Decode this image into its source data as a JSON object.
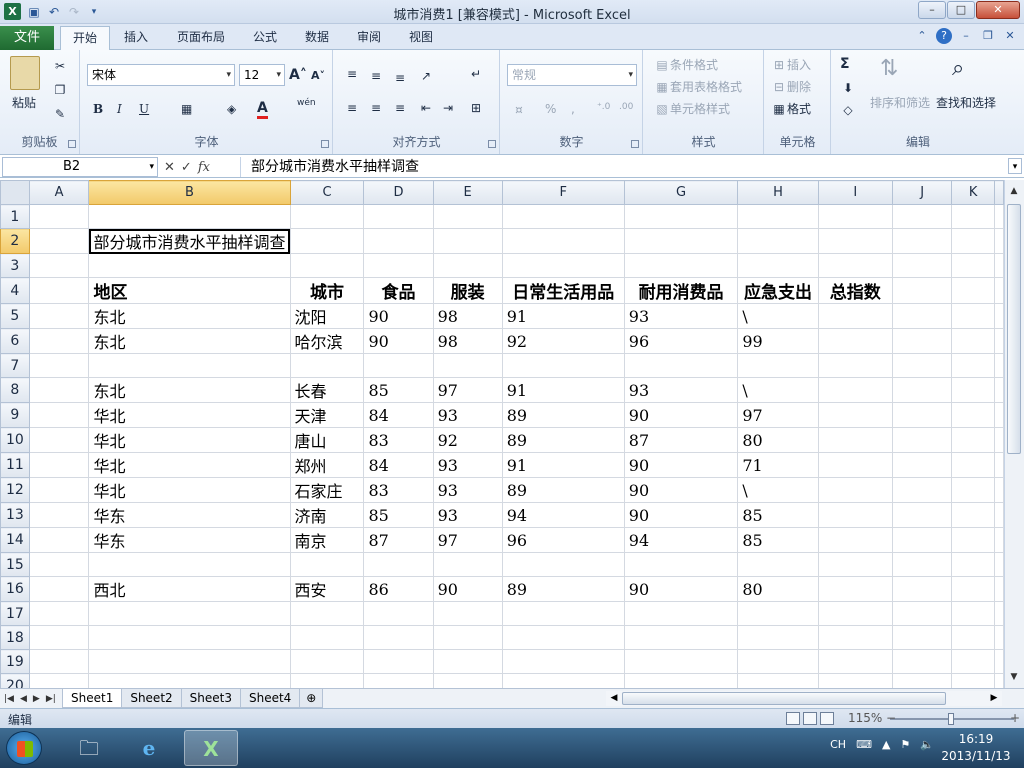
{
  "window": {
    "title": "城市消费1  [兼容模式] - Microsoft Excel",
    "logo": "X",
    "minimize": "–",
    "maximize": "□",
    "close": "✕"
  },
  "ribbon_tabs": {
    "file": "文件",
    "items": [
      "开始",
      "插入",
      "页面布局",
      "公式",
      "数据",
      "审阅",
      "视图"
    ]
  },
  "ribbon": {
    "clipboard": {
      "paste": "粘贴",
      "label": "剪贴板"
    },
    "font": {
      "name": "宋体",
      "size": "12",
      "bold": "B",
      "italic": "I",
      "underline": "U",
      "label": "字体",
      "font_color": "A",
      "wen": "wén"
    },
    "alignment": {
      "label": "对齐方式"
    },
    "number": {
      "format": "常规",
      "percent": "%",
      "comma": ",",
      "label": "数字"
    },
    "styles": {
      "conditional": "条件格式",
      "table": "套用表格格式",
      "cell": "单元格样式",
      "label": "样式"
    },
    "cells": {
      "insert": "插入",
      "delete": "删除",
      "format": "格式",
      "label": "单元格"
    },
    "editing": {
      "sigma": "Σ",
      "sort": "排序和筛选",
      "find": "查找和选择",
      "label": "编辑"
    }
  },
  "formula_bar": {
    "name_box": "B2",
    "fx": "fx",
    "cancel": "✕",
    "enter": "✓",
    "content": "部分城市消费水平抽样调查"
  },
  "sheet": {
    "columns": [
      "A",
      "B",
      "C",
      "D",
      "E",
      "F",
      "G",
      "H",
      "I",
      "J",
      "K"
    ],
    "selected_column": "B",
    "selected_row": "2",
    "rows": [
      {
        "n": "1",
        "cells": [
          "",
          "",
          "",
          "",
          "",
          "",
          "",
          "",
          "",
          "",
          ""
        ]
      },
      {
        "n": "2",
        "cells": [
          "",
          "部分城市消费水平抽样调查",
          "",
          "",
          "",
          "",
          "",
          "",
          "",
          "",
          ""
        ]
      },
      {
        "n": "3",
        "cells": [
          "",
          "",
          "",
          "",
          "",
          "",
          "",
          "",
          "",
          "",
          ""
        ]
      },
      {
        "n": "4",
        "cells": [
          "",
          "地区",
          "城市",
          "食品",
          "服装",
          "日常生活用品",
          "耐用消费品",
          "应急支出",
          "总指数",
          "",
          ""
        ]
      },
      {
        "n": "5",
        "cells": [
          "",
          "东北",
          "沈阳",
          "90",
          "98",
          "91",
          "93",
          "\\",
          "",
          "",
          ""
        ]
      },
      {
        "n": "6",
        "cells": [
          "",
          "东北",
          "哈尔滨",
          "90",
          "98",
          "92",
          "96",
          "99",
          "",
          "",
          ""
        ]
      },
      {
        "n": "7",
        "cells": [
          "",
          "",
          "",
          "",
          "",
          "",
          "",
          "",
          "",
          "",
          ""
        ]
      },
      {
        "n": "8",
        "cells": [
          "",
          "东北",
          "长春",
          "85",
          "97",
          "91",
          "93",
          "\\",
          "",
          "",
          ""
        ]
      },
      {
        "n": "9",
        "cells": [
          "",
          "华北",
          "天津",
          "84",
          "93",
          "89",
          "90",
          "97",
          "",
          "",
          ""
        ]
      },
      {
        "n": "10",
        "cells": [
          "",
          "华北",
          "唐山",
          "83",
          "92",
          "89",
          "87",
          "80",
          "",
          "",
          ""
        ]
      },
      {
        "n": "11",
        "cells": [
          "",
          "华北",
          "郑州",
          "84",
          "93",
          "91",
          "90",
          "71",
          "",
          "",
          ""
        ]
      },
      {
        "n": "12",
        "cells": [
          "",
          "华北",
          "石家庄",
          "83",
          "93",
          "89",
          "90",
          "\\",
          "",
          "",
          ""
        ]
      },
      {
        "n": "13",
        "cells": [
          "",
          "华东",
          "济南",
          "85",
          "93",
          "94",
          "90",
          "85",
          "",
          "",
          ""
        ]
      },
      {
        "n": "14",
        "cells": [
          "",
          "华东",
          "南京",
          "87",
          "97",
          "96",
          "94",
          "85",
          "",
          "",
          ""
        ]
      },
      {
        "n": "15",
        "cells": [
          "",
          "",
          "",
          "",
          "",
          "",
          "",
          "",
          "",
          "",
          ""
        ]
      },
      {
        "n": "16",
        "cells": [
          "",
          "西北",
          "西安",
          "86",
          "90",
          "89",
          "90",
          "80",
          "",
          "",
          ""
        ]
      },
      {
        "n": "17",
        "cells": [
          "",
          "",
          "",
          "",
          "",
          "",
          "",
          "",
          "",
          "",
          ""
        ]
      },
      {
        "n": "18",
        "cells": [
          "",
          "",
          "",
          "",
          "",
          "",
          "",
          "",
          "",
          "",
          ""
        ]
      },
      {
        "n": "19",
        "cells": [
          "",
          "",
          "",
          "",
          "",
          "",
          "",
          "",
          "",
          "",
          ""
        ]
      },
      {
        "n": "20",
        "cells": [
          "",
          "",
          "",
          "",
          "",
          "",
          "",
          "",
          "",
          "",
          ""
        ]
      }
    ]
  },
  "sheet_tabs": [
    "Sheet1",
    "Sheet2",
    "Sheet3",
    "Sheet4"
  ],
  "active_sheet": "Sheet1",
  "status": {
    "mode": "编辑",
    "zoom": "115%",
    "zoom_minus": "−",
    "zoom_plus": "+"
  },
  "taskbar": {
    "ime": "CH",
    "time": "16:19",
    "date": "2013/11/13"
  }
}
